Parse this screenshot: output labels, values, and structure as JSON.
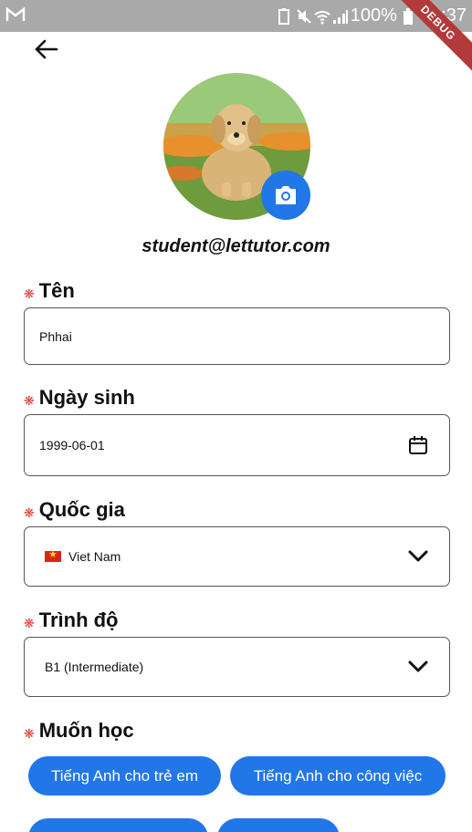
{
  "status_bar": {
    "battery_text": "100%",
    "time": "23:37"
  },
  "debug_banner": "DEBUG",
  "profile": {
    "email": "student@lettutor.com"
  },
  "form": {
    "name": {
      "label": "Tên",
      "value": "Phhai"
    },
    "birthday": {
      "label": "Ngày sinh",
      "value": "1999-06-01"
    },
    "country": {
      "label": "Quốc gia",
      "value": "Viet Nam"
    },
    "level": {
      "label": "Trình độ",
      "value": "B1 (Intermediate)"
    },
    "want_to_learn": {
      "label": "Muốn học",
      "chips": [
        "Tiếng Anh cho trẻ em",
        "Tiếng Anh cho công việc"
      ]
    }
  },
  "colors": {
    "accent": "#2176e8",
    "required": "#e53935",
    "status_bar": "#a9a9a9",
    "debug": "#b23a3a"
  }
}
